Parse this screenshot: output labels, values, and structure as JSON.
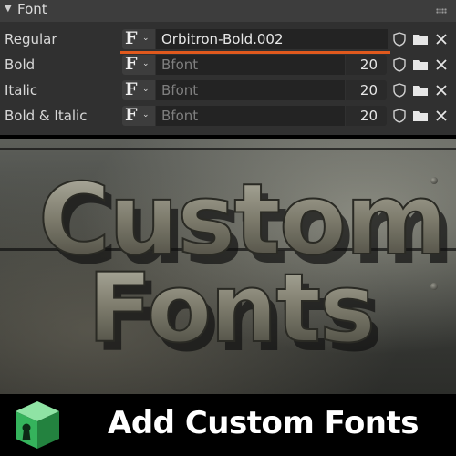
{
  "panel": {
    "title": "Font",
    "rows": [
      {
        "label": "Regular",
        "font_name": "Orbitron-Bold.002",
        "size": ""
      },
      {
        "label": "Bold",
        "font_name": "Bfont",
        "size": "20"
      },
      {
        "label": "Italic",
        "font_name": "Bfont",
        "size": "20"
      },
      {
        "label": "Bold & Italic",
        "font_name": "Bfont",
        "size": "20"
      }
    ],
    "picker_glyph": "F",
    "icons": [
      "fake-user-shield-icon",
      "folder-icon",
      "unlink-x-icon"
    ]
  },
  "hero": {
    "line1": "Custom",
    "line2": "Fonts"
  },
  "banner": {
    "text": "Add Custom Fonts",
    "logo_icon": "keyhole-cube-icon"
  },
  "colors": {
    "accent_underline": "#e0591d",
    "panel_bg": "#303030",
    "field_bg": "#232323",
    "logo_green": "#3fc46a"
  }
}
